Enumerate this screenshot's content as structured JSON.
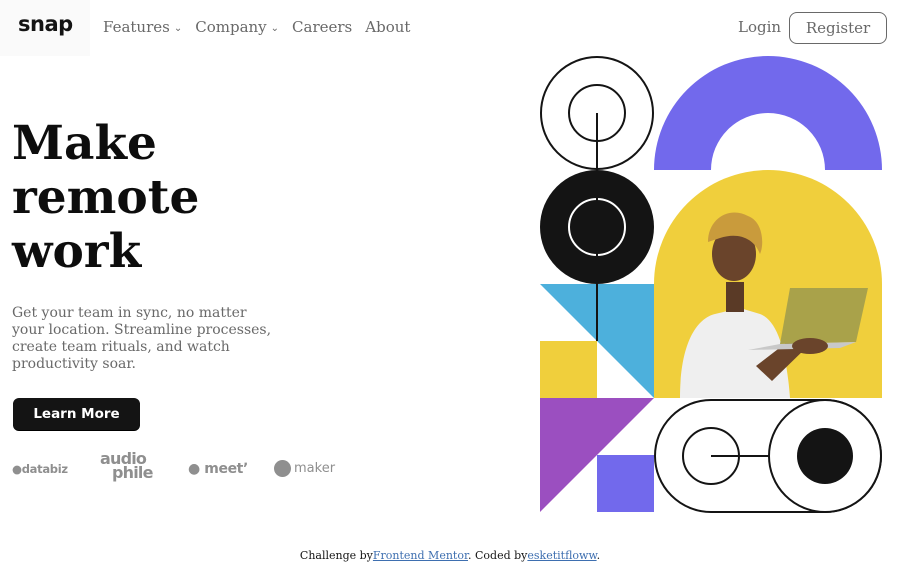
{
  "header": {
    "logo": "snap",
    "nav": [
      {
        "label": "Features",
        "has_dropdown": true
      },
      {
        "label": "Company",
        "has_dropdown": true
      },
      {
        "label": "Careers",
        "has_dropdown": false
      },
      {
        "label": "About",
        "has_dropdown": false
      }
    ],
    "login": "Login",
    "register": "Register"
  },
  "hero": {
    "title_lines": [
      "Make",
      "remote",
      "work"
    ],
    "description": "Get your team in sync, no matter your location. Streamline processes, create team rituals, and watch productivity soar.",
    "cta": "Learn More"
  },
  "clients": {
    "databiz": "databiz",
    "audiophile_top": "audio",
    "audiophile_bottom": "phile",
    "meet": "meet",
    "maker": "maker"
  },
  "footer": {
    "prefix": "Challenge by",
    "link1": "Frontend Mentor",
    "middle": ". Coded by",
    "link2": "esketitfloww",
    "suffix": "."
  },
  "colors": {
    "purple": "#7269ec",
    "yellow": "#f0cf3c",
    "blue": "#4db0dc",
    "violet": "#9b4fc0",
    "ink": "#141414",
    "muted": "#696969"
  }
}
